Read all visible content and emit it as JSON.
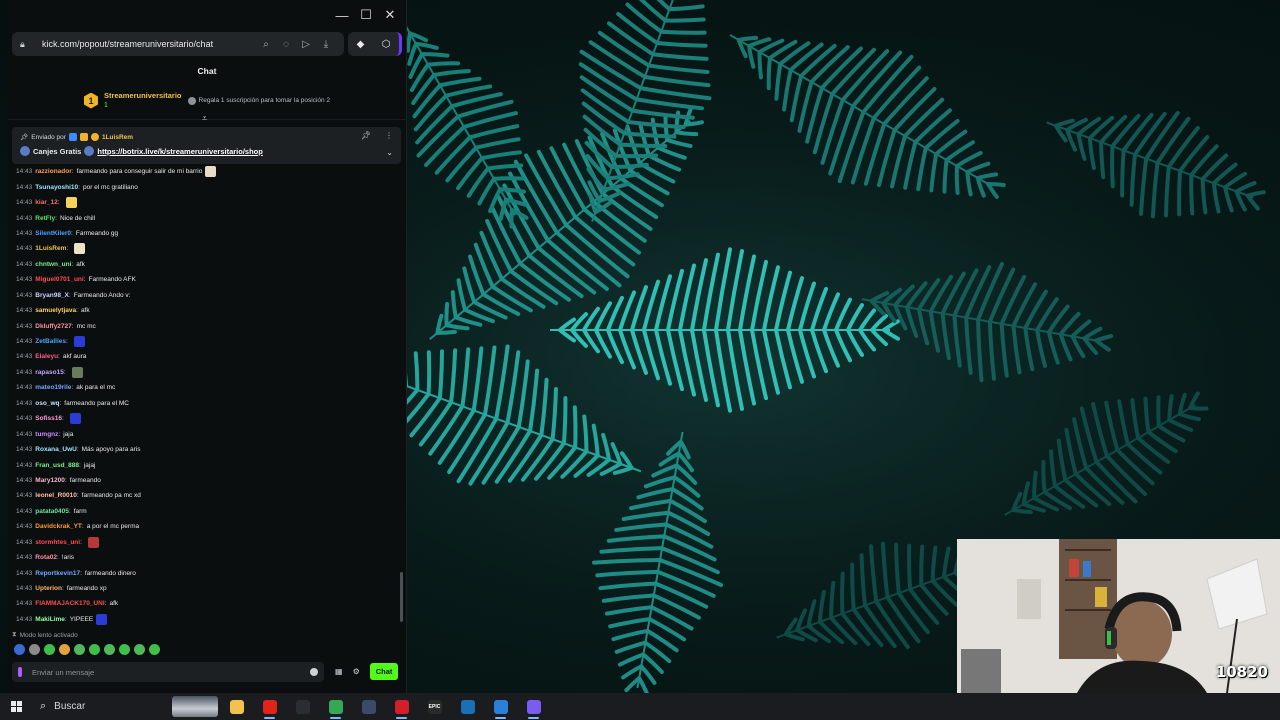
{
  "window": {
    "controls": {
      "minimize": "—",
      "maximize": "☐",
      "close": "✕"
    },
    "url": "kick.com/popout/streameruniversitario/chat"
  },
  "chat": {
    "title": "Chat",
    "leaderboard": {
      "rank": "1",
      "name": "Streameruniversitario",
      "count": "1",
      "hint": "Regala 1 suscripción para tomar la posición 2"
    },
    "pinned": {
      "sent_by_label": "Enviado por",
      "sent_by_user": "1LuisRem",
      "title": "Canjes Gratis",
      "link": "https://botrix.live/k/streameruniversitario/shop"
    },
    "messages": [
      {
        "time": "14:43",
        "user": "razzionador",
        "color": "#ff9a5a",
        "text": "farmeando para conseguir salir de mi barrio",
        "emote": "#e9dcc4"
      },
      {
        "time": "14:43",
        "user": "Tsunayoshi10",
        "color": "#9ee6ff",
        "text": "por el mc gratiliano",
        "emote": ""
      },
      {
        "time": "14:43",
        "user": "kiar_12",
        "color": "#ff6b6b",
        "text": "",
        "emote": "#f3d35a"
      },
      {
        "time": "14:43",
        "user": "RetFly",
        "color": "#5ee26b",
        "text": "Nice de chill",
        "emote": ""
      },
      {
        "time": "14:43",
        "user": "SilentKiler0",
        "color": "#4aa3ff",
        "text": "Farmeando gg",
        "emote": ""
      },
      {
        "time": "14:43",
        "user": "1LuisRem",
        "color": "#f0c24b",
        "text": "",
        "emote": "#efe3c6"
      },
      {
        "time": "14:43",
        "user": "chntwn_uni",
        "color": "#7cf08c",
        "text": "afk",
        "emote": ""
      },
      {
        "time": "14:43",
        "user": "Miguel0701_uni",
        "color": "#ff4d4d",
        "text": "Farmeando AFK",
        "emote": ""
      },
      {
        "time": "14:43",
        "user": "Bryan98_X",
        "color": "#c9d1ff",
        "text": "Farmeando Ando v:",
        "emote": ""
      },
      {
        "time": "14:43",
        "user": "samuelytjava",
        "color": "#ffd166",
        "text": "afk",
        "emote": ""
      },
      {
        "time": "14:43",
        "user": "Dkluffy2727",
        "color": "#ff8fa3",
        "text": "mc mc",
        "emote": ""
      },
      {
        "time": "14:43",
        "user": "ZetBallies",
        "color": "#4aa3ff",
        "text": "",
        "emote": "#2b3bd6"
      },
      {
        "time": "14:43",
        "user": "Elaleyu",
        "color": "#ff5c8a",
        "text": "akf aura",
        "emote": ""
      },
      {
        "time": "14:43",
        "user": "rapaso15",
        "color": "#c8a2ff",
        "text": "",
        "emote": "#6a7b5c"
      },
      {
        "time": "14:43",
        "user": "mateo19rile",
        "color": "#6ea8ff",
        "text": "ak para el mc",
        "emote": ""
      },
      {
        "time": "14:43",
        "user": "oso_wq",
        "color": "#bfe3ff",
        "text": "farmeando para el MC",
        "emote": ""
      },
      {
        "time": "14:43",
        "user": "Sofiss16",
        "color": "#ff9ad5",
        "text": "",
        "emote": "#2b3bd6"
      },
      {
        "time": "14:43",
        "user": "tumgnz",
        "color": "#c88bff",
        "text": "jaja",
        "emote": ""
      },
      {
        "time": "14:43",
        "user": "Roxana_UwU",
        "color": "#9ee6ff",
        "text": "Más apoyo para aris",
        "emote": ""
      },
      {
        "time": "14:43",
        "user": "Fran_usd_888",
        "color": "#7cf08c",
        "text": "jajaj",
        "emote": ""
      },
      {
        "time": "14:43",
        "user": "Mary1200",
        "color": "#ffb3c7",
        "text": "farmeando",
        "emote": ""
      },
      {
        "time": "14:43",
        "user": "leonel_R0010",
        "color": "#ffc2a8",
        "text": "farmeando pa mc xd",
        "emote": ""
      },
      {
        "time": "14:43",
        "user": "patata0405",
        "color": "#6ee2a0",
        "text": "farm",
        "emote": ""
      },
      {
        "time": "14:43",
        "user": "Davidckrak_YT",
        "color": "#ff9a3c",
        "text": "a por el mc perma",
        "emote": ""
      },
      {
        "time": "14:43",
        "user": "stormhtes_uni",
        "color": "#ff4d4d",
        "text": "",
        "emote": "#b43a3a"
      },
      {
        "time": "14:43",
        "user": "Rota02",
        "color": "#ff8fa3",
        "text": "!aris",
        "emote": ""
      },
      {
        "time": "14:43",
        "user": "Reportkevin17",
        "color": "#6ea8ff",
        "text": "farmeando dinero",
        "emote": ""
      },
      {
        "time": "14:43",
        "user": "Upterion",
        "color": "#ffb36b",
        "text": "farmeando xp",
        "emote": ""
      },
      {
        "time": "14:43",
        "user": "FIAMMAJACK170_UNI",
        "color": "#ff4d4d",
        "text": "afk",
        "emote": ""
      },
      {
        "time": "14:43",
        "user": "MakiLime",
        "color": "#8effa0",
        "text": "YIPEEE",
        "emote": "#2b3bd6"
      }
    ],
    "slow_mode": "Modo lento activado",
    "composer_placeholder": "Enviar un mensaje",
    "send_button": "Chat"
  },
  "webcam": {
    "counter": "10820"
  },
  "taskbar": {
    "search_label": "Buscar",
    "apps": [
      {
        "icon": "file-explorer-icon",
        "color": "#f2c14e",
        "label": ""
      },
      {
        "icon": "opera-browser-icon",
        "color": "#e2231a",
        "label": ""
      },
      {
        "icon": "league-app-icon",
        "color": "#2a2d33",
        "label": ""
      },
      {
        "icon": "chrome-icon",
        "color": "#34a853",
        "label": ""
      },
      {
        "icon": "virtual-machine-icon",
        "color": "#3a4a6a",
        "label": ""
      },
      {
        "icon": "record-app-icon",
        "color": "#d21f2a",
        "label": ""
      },
      {
        "icon": "epic-games-icon",
        "color": "#2a2a2a",
        "label": "EPIC"
      },
      {
        "icon": "steam-icon",
        "color": "#1b6fb5",
        "label": ""
      },
      {
        "icon": "vscode-icon",
        "color": "#2b7fd6",
        "label": ""
      },
      {
        "icon": "discord-icon",
        "color": "#7b5cf0",
        "label": ""
      }
    ]
  }
}
